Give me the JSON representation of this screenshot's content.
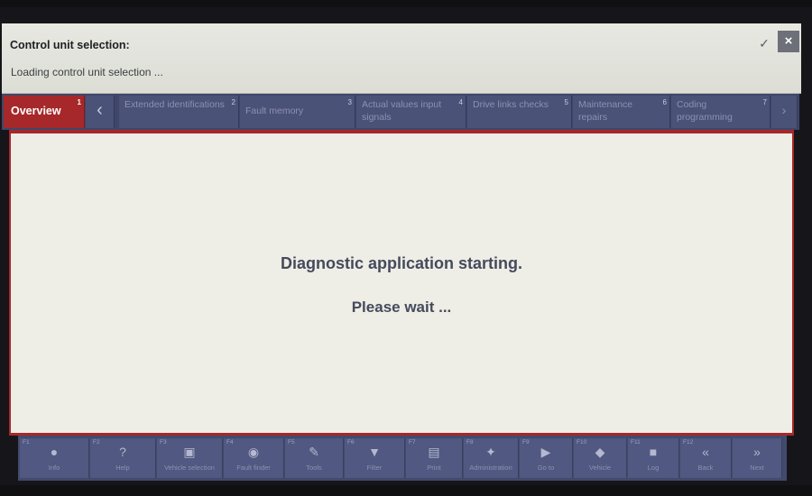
{
  "header": {
    "title": "Control unit selection:",
    "status": "Loading control unit selection ..."
  },
  "tabs": [
    {
      "label": "Overview",
      "num": "1",
      "active": true
    },
    {
      "label": "Extended identifications",
      "num": "2"
    },
    {
      "label": "Fault memory",
      "num": "3"
    },
    {
      "label": "Actual values input signals",
      "num": "4"
    },
    {
      "label": "Drive links checks",
      "num": "5"
    },
    {
      "label": "Maintenance repairs",
      "num": "6"
    },
    {
      "label": "Coding programming",
      "num": "7"
    }
  ],
  "content": {
    "message": "Diagnostic application starting.",
    "wait": "Please wait ..."
  },
  "footer": {
    "buttons": [
      {
        "key": "F1",
        "label": "Info",
        "icon": "info-icon"
      },
      {
        "key": "F2",
        "label": "Help",
        "icon": "help-icon"
      },
      {
        "key": "F3",
        "label": "Vehicle selection",
        "icon": "vehicle-icon"
      },
      {
        "key": "F4",
        "label": "Fault finder",
        "icon": "fault-icon"
      },
      {
        "key": "F5",
        "label": "Tools",
        "icon": "tools-icon"
      },
      {
        "key": "F6",
        "label": "Filter",
        "icon": "filter-icon"
      },
      {
        "key": "F7",
        "label": "Print",
        "icon": "print-icon"
      },
      {
        "key": "F8",
        "label": "Administration",
        "icon": "admin-icon"
      },
      {
        "key": "F9",
        "label": "Go to",
        "icon": "goto-icon"
      },
      {
        "key": "F10",
        "label": "Vehicle",
        "icon": "car-icon"
      },
      {
        "key": "F11",
        "label": "Log",
        "icon": "log-icon"
      },
      {
        "key": "F12",
        "label": "Back",
        "icon": "back-icon"
      },
      {
        "key": "",
        "label": "Next",
        "icon": "forward-icon"
      }
    ]
  }
}
